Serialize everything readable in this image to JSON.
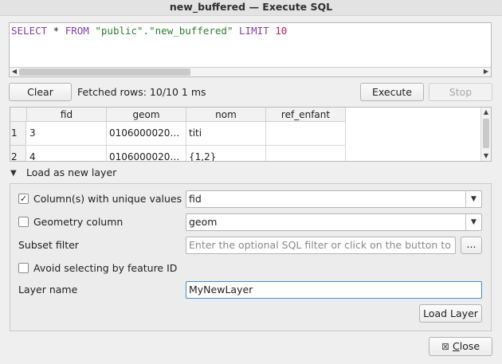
{
  "window": {
    "title": "new_buffered — Execute SQL"
  },
  "sql": {
    "select": "SELECT",
    "star": " * ",
    "from": "FROM",
    "schema": "\"public\"",
    "dot": ".",
    "table": "\"new_buffered\"",
    "limit": "LIMIT",
    "limit_value": "10"
  },
  "toolbar": {
    "clear_label": "Clear",
    "status": "Fetched rows: 10/10  1 ms",
    "execute_label": "Execute",
    "stop_label": "Stop"
  },
  "results": {
    "columns": [
      "fid",
      "geom",
      "nom",
      "ref_enfant"
    ],
    "rows": [
      {
        "num": "1",
        "cells": [
          "3",
          "0106000020…",
          "titi",
          ""
        ]
      },
      {
        "num": "2",
        "cells": [
          "4",
          "0106000020…",
          "{1,2}",
          ""
        ]
      }
    ]
  },
  "load_section": {
    "title": "Load as new layer",
    "unique_checkbox_label": "Column(s) with unique values",
    "unique_checked": true,
    "unique_value": "fid",
    "geometry_checkbox_label": "Geometry column",
    "geometry_checked": false,
    "geometry_value": "geom",
    "subset_label": "Subset filter",
    "subset_placeholder": "Enter the optional SQL filter or click on the button to ...",
    "subset_button": "...",
    "avoid_label": "Avoid selecting by feature ID",
    "avoid_checked": false,
    "layer_name_label": "Layer name",
    "layer_name_value": "MyNewLayer",
    "load_button": "Load Layer"
  },
  "footer": {
    "close_label": "Close",
    "close_mnemonic": "C",
    "close_rest": "lose"
  }
}
